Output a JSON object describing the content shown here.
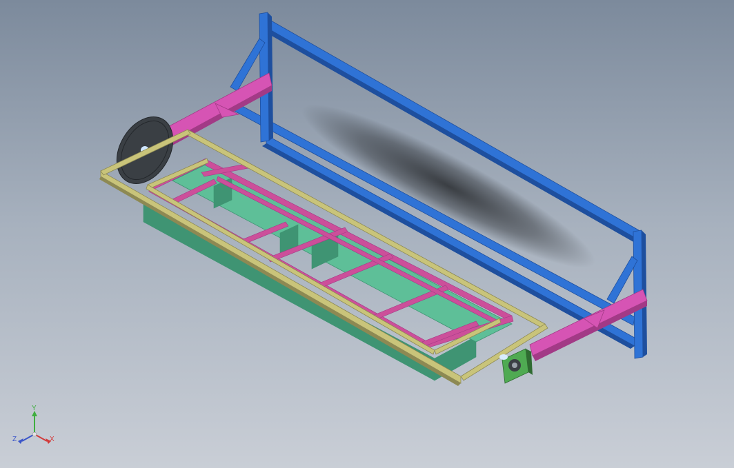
{
  "viewport": {
    "background_top": "#7c8a9c",
    "background_bottom": "#c9ced6"
  },
  "model": {
    "colors": {
      "frame_blue": "#2f73d6",
      "frame_blue_dark": "#1e4f9e",
      "arm_magenta": "#d654b4",
      "arm_magenta_dark": "#a23a86",
      "tray_frame": "#c9c47a",
      "tray_frame_dark": "#8d8953",
      "inner_frame": "#cc4f9a",
      "tub_green": "#5ebf98",
      "tub_green_dark": "#3f9473",
      "bearing_plate": "#3a3f44",
      "motor_green": "#4faa52"
    }
  },
  "triad": {
    "x_label": "X",
    "y_label": "Y",
    "z_label": "Z",
    "x_color": "#d23a3a",
    "y_color": "#3fae3f",
    "z_color": "#3a55c9"
  }
}
